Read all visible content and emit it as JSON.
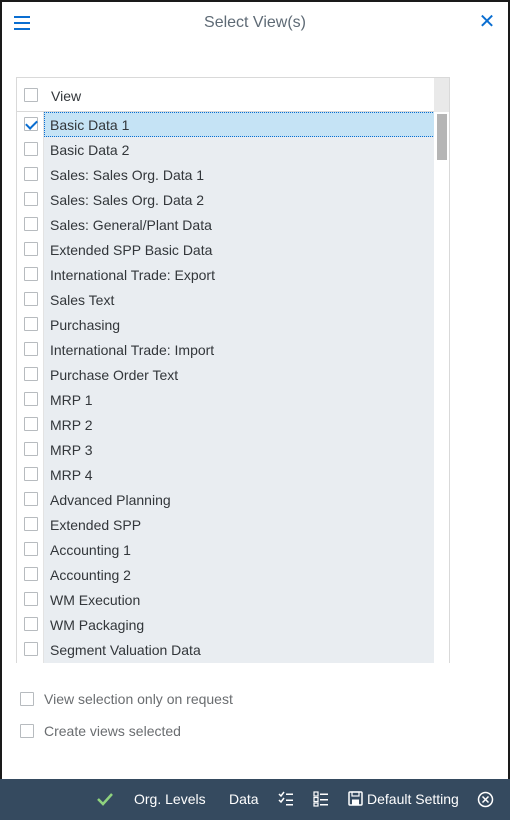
{
  "header": {
    "title": "Select View(s)"
  },
  "table": {
    "column_header": "View",
    "rows": [
      {
        "label": "Basic Data 1",
        "checked": true
      },
      {
        "label": "Basic Data 2",
        "checked": false
      },
      {
        "label": "Sales: Sales Org. Data 1",
        "checked": false
      },
      {
        "label": "Sales: Sales Org. Data 2",
        "checked": false
      },
      {
        "label": "Sales: General/Plant Data",
        "checked": false
      },
      {
        "label": "Extended SPP Basic Data",
        "checked": false
      },
      {
        "label": "International Trade: Export",
        "checked": false
      },
      {
        "label": "Sales Text",
        "checked": false
      },
      {
        "label": "Purchasing",
        "checked": false
      },
      {
        "label": "International Trade: Import",
        "checked": false
      },
      {
        "label": "Purchase Order Text",
        "checked": false
      },
      {
        "label": "MRP 1",
        "checked": false
      },
      {
        "label": "MRP 2",
        "checked": false
      },
      {
        "label": "MRP 3",
        "checked": false
      },
      {
        "label": "MRP 4",
        "checked": false
      },
      {
        "label": "Advanced Planning",
        "checked": false
      },
      {
        "label": "Extended SPP",
        "checked": false
      },
      {
        "label": "Accounting 1",
        "checked": false
      },
      {
        "label": "Accounting 2",
        "checked": false
      },
      {
        "label": "WM Execution",
        "checked": false
      },
      {
        "label": "WM Packaging",
        "checked": false
      },
      {
        "label": "Segment Valuation Data",
        "checked": false
      }
    ]
  },
  "options": {
    "view_on_request": "View selection only on request",
    "create_views": "Create views selected"
  },
  "footer": {
    "org_levels": "Org. Levels",
    "data": "Data",
    "default_setting": "Default Setting"
  },
  "colors": {
    "accent": "#0a6ed1",
    "footer_bg": "#354a5f",
    "row_bg": "#e9edf1",
    "selected_row_bg": "#c5e3f5",
    "confirm_green": "#8fd27e"
  },
  "icons": {
    "menu": "hamburger-icon",
    "close": "close-icon",
    "confirm": "checkmark-icon",
    "select_all": "checklist-icon",
    "deselect_all": "list-icon",
    "save": "save-icon",
    "cancel": "cancel-circle-icon"
  }
}
